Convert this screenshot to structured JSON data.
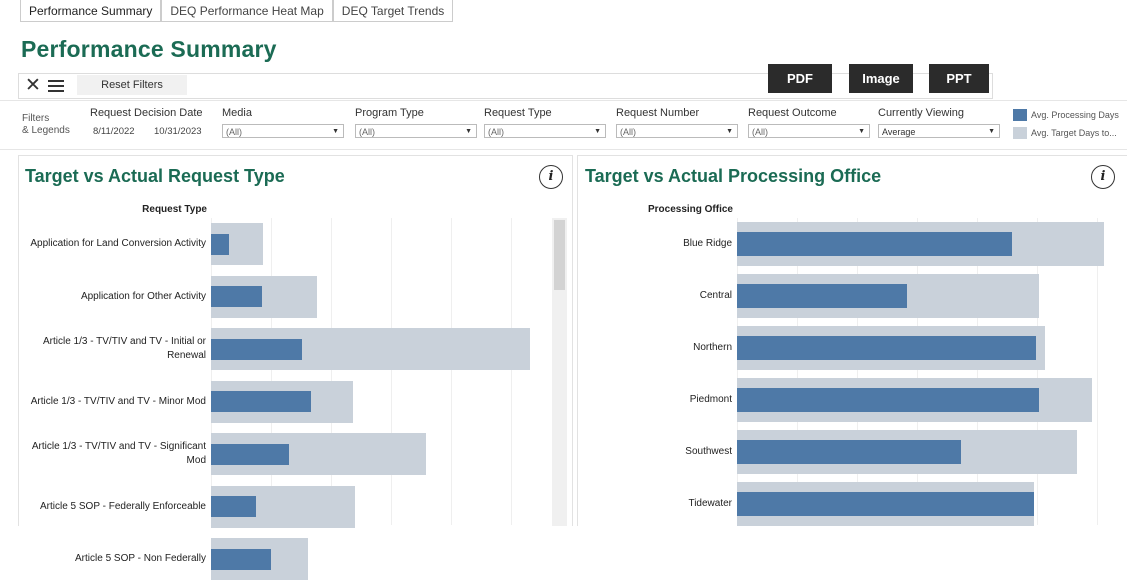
{
  "tabs": [
    "Performance Summary",
    "DEQ Performance Heat Map",
    "DEQ Target Trends"
  ],
  "page_title": "Performance Summary",
  "toolbar": {
    "reset_label": "Reset Filters",
    "pdf_label": "PDF",
    "image_label": "Image",
    "ppt_label": "PPT"
  },
  "filters": {
    "label_line1": "Filters",
    "label_line2": "& Legends",
    "date_title": "Request Decision Date",
    "date_start": "8/11/2022",
    "date_end": "10/31/2023",
    "media_title": "Media",
    "media_value": "(All)",
    "program_title": "Program Type",
    "program_value": "(All)",
    "reqtype_title": "Request Type",
    "reqtype_value": "(All)",
    "reqnum_title": "Request Number",
    "reqnum_value": "(All)",
    "outcome_title": "Request Outcome",
    "outcome_value": "(All)",
    "viewing_title": "Currently Viewing",
    "viewing_value": "Average"
  },
  "legend": [
    {
      "label": "Avg. Processing Days",
      "color": "#4e79a7"
    },
    {
      "label": "Avg. Target Days to...",
      "color": "#c9d1da"
    }
  ],
  "left_panel": {
    "title": "Target vs Actual Request Type",
    "column_header": "Request Type"
  },
  "right_panel": {
    "title": "Target vs Actual Processing Office",
    "column_header": "Processing Office"
  },
  "chart_data": [
    {
      "type": "bar",
      "orientation": "horizontal",
      "categories": [
        "Application for Land Conversion Activity",
        "Application for Other Activity",
        "Article 1/3 - TV/TIV and TV - Initial or Renewal",
        "Article 1/3 - TV/TIV and TV - Minor Mod",
        "Article 1/3 - TV/TIV and TV - Significant Mod",
        "Article 5 SOP - Federally Enforceable",
        "Article 5 SOP - Non Federally"
      ],
      "series": [
        {
          "name": "Avg. Processing Days",
          "values": [
            15,
            43,
            77,
            85,
            66,
            38,
            51
          ]
        },
        {
          "name": "Avg. Target Days to...",
          "values": [
            44,
            90,
            270,
            120,
            182,
            122,
            82
          ]
        }
      ],
      "xlim": [
        0,
        275
      ]
    },
    {
      "type": "bar",
      "orientation": "horizontal",
      "categories": [
        "Blue Ridge",
        "Central",
        "Northern",
        "Piedmont",
        "Southwest",
        "Tidewater"
      ],
      "series": [
        {
          "name": "Avg. Processing Days",
          "values": [
            152,
            94,
            165,
            167,
            124,
            164
          ]
        },
        {
          "name": "Avg. Target Days to...",
          "values": [
            203,
            167,
            170,
            196,
            188,
            164
          ]
        }
      ],
      "xlim": [
        0,
        210
      ]
    }
  ]
}
